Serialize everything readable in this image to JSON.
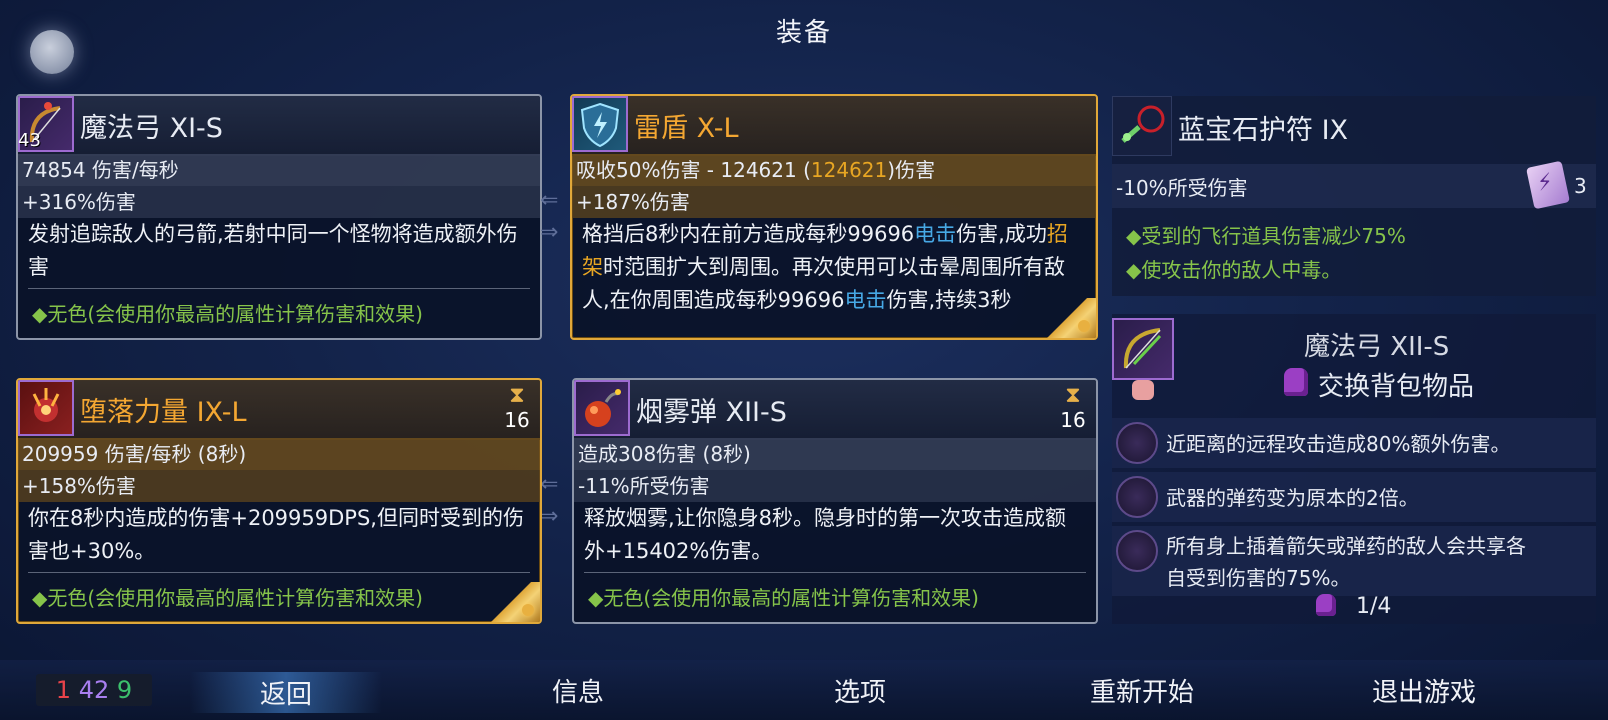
{
  "header": {
    "title": "装备"
  },
  "cards": {
    "bow": {
      "name": "魔法弓 XI-S",
      "level": "43",
      "stat1": "74854 伤害/每秒",
      "stat2": "+316%伤害",
      "desc": "发射追踪敌人的弓箭,若射中同一个怪物将造成额外伤害",
      "footer": "◆无色(会使用你最高的属性计算伤害和效果)"
    },
    "shield": {
      "name": "雷盾 X-L",
      "stat1_prefix": "吸收50%伤害 - 124621 (",
      "stat1_highlight": "124621",
      "stat1_suffix": ")伤害",
      "stat2": "+187%伤害",
      "desc_a": "格挡后8秒内在前方造成每秒99696",
      "desc_b": "电击",
      "desc_c": "伤害,成功",
      "desc_d": "招架",
      "desc_e": "时范围扩大到周围。再次使用可以击晕周围所有敌人,在你周围造成每秒99696",
      "desc_f": "电击",
      "desc_g": "伤害,持续3秒"
    },
    "fall": {
      "name": "堕落力量 IX-L",
      "timer": "16",
      "stat1": "209959 伤害/每秒 (8秒)",
      "stat2": "+158%伤害",
      "desc": "你在8秒内造成的伤害+209959DPS,但同时受到的伤害也+30%。",
      "footer": "◆无色(会使用你最高的属性计算伤害和效果)"
    },
    "smoke": {
      "name": "烟雾弹 XII-S",
      "timer": "16",
      "stat1": "造成308伤害 (8秒)",
      "stat2": "-11%所受伤害",
      "desc": "释放烟雾,让你隐身8秒。隐身时的第一次攻击造成额外+15402%伤害。",
      "footer": "◆无色(会使用你最高的属性计算伤害和效果)"
    }
  },
  "amulet": {
    "name": "蓝宝石护符 IX",
    "stat": "-10%所受伤害",
    "scroll_count": "3",
    "effects": [
      "◆受到的飞行道具伤害减少75%",
      "◆使攻击你的敌人中毒。"
    ]
  },
  "swap": {
    "item_name": "魔法弓 XII-S",
    "action": "交换背包物品",
    "perks": [
      "近距离的远程攻击造成80%额外伤害。",
      "武器的弹药变为原本的2倍。",
      "所有身上插着箭矢或弹药的敌人会共享各",
      "自受到伤害的75%。"
    ],
    "page": "1/4"
  },
  "footer": {
    "counter": {
      "red": "1",
      "purple": "42",
      "green": "9"
    },
    "nav": [
      "返回",
      "信息",
      "选项",
      "重新开始",
      "退出游戏"
    ]
  }
}
